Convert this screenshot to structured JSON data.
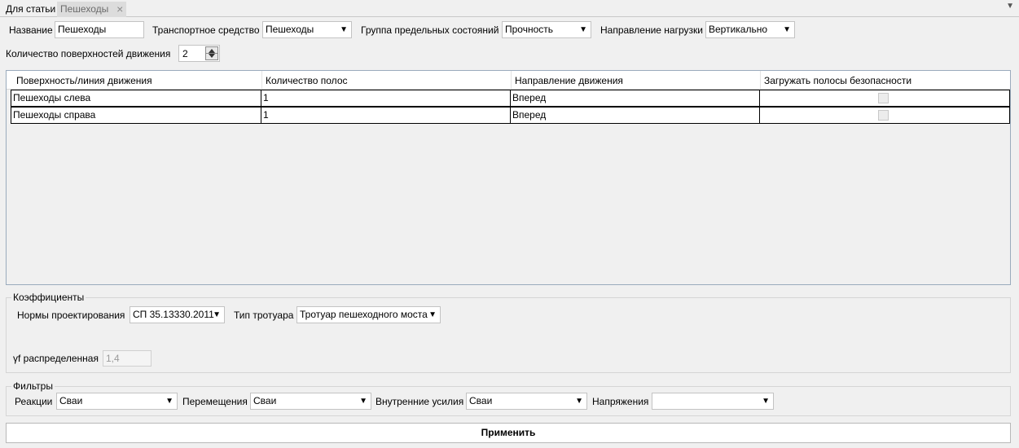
{
  "tabs": [
    {
      "label": "Для статьи"
    },
    {
      "label": "Пешеходы",
      "close": "×"
    }
  ],
  "tab_menu_icon": "▼",
  "form": {
    "name_label": "Название",
    "name_value": "Пешеходы",
    "vehicle_label": "Транспортное средство",
    "vehicle_value": "Пешеходы",
    "limit_group_label": "Группа предельных состояний",
    "limit_group_value": "Прочность",
    "load_dir_label": "Направление нагрузки",
    "load_dir_value": "Вертикально",
    "surfaces_label": "Количество поверхностей движения",
    "surfaces_value": "2"
  },
  "grid": {
    "columns": [
      "Поверхность/линия движения",
      "Количество полос",
      "Направление движения",
      "Загружать полосы безопасности"
    ],
    "rows": [
      {
        "surface": "Пешеходы слева",
        "lanes": "1",
        "direction": "Вперед",
        "safety": false
      },
      {
        "surface": "Пешеходы справа",
        "lanes": "1",
        "direction": "Вперед",
        "safety": false
      }
    ]
  },
  "coefficients": {
    "title": "Коэффициенты",
    "norms_label": "Нормы проектирования",
    "norms_value": "СП 35.13330.2011",
    "sidewalk_label": "Тип тротуара",
    "sidewalk_value": "Тротуар пешеходного моста",
    "distributed_label": "γf распределенная",
    "distributed_value": "1,4"
  },
  "filters": {
    "title": "Фильтры",
    "reactions_label": "Реакции",
    "reactions_value": "Сваи",
    "displacements_label": "Перемещения",
    "displacements_value": "Сваи",
    "forces_label": "Внутренние усилия",
    "forces_value": "Сваи",
    "stresses_label": "Напряжения",
    "stresses_value": ""
  },
  "apply_label": "Применить",
  "dropdown_arrow": "▼"
}
